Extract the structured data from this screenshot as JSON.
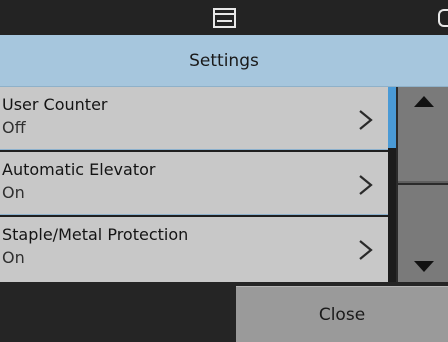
{
  "header": {
    "title": "Settings"
  },
  "status_icons": [
    "tray-icon",
    "battery-icon"
  ],
  "settings": {
    "items": [
      {
        "label": "User Counter",
        "value": "Off"
      },
      {
        "label": "Automatic Elevator",
        "value": "On"
      },
      {
        "label": "Staple/Metal Protection",
        "value": "On"
      }
    ]
  },
  "footer": {
    "close_label": "Close"
  },
  "colors": {
    "title_bar": "#a6c6dd",
    "list_item": "#c8c8c8",
    "divider": "#8db1cd",
    "scroll_thumb": "#4a9ad6",
    "scroll_button": "#7a7a7a",
    "close_button": "#9a9a9a",
    "background": "#2b2b2b"
  }
}
